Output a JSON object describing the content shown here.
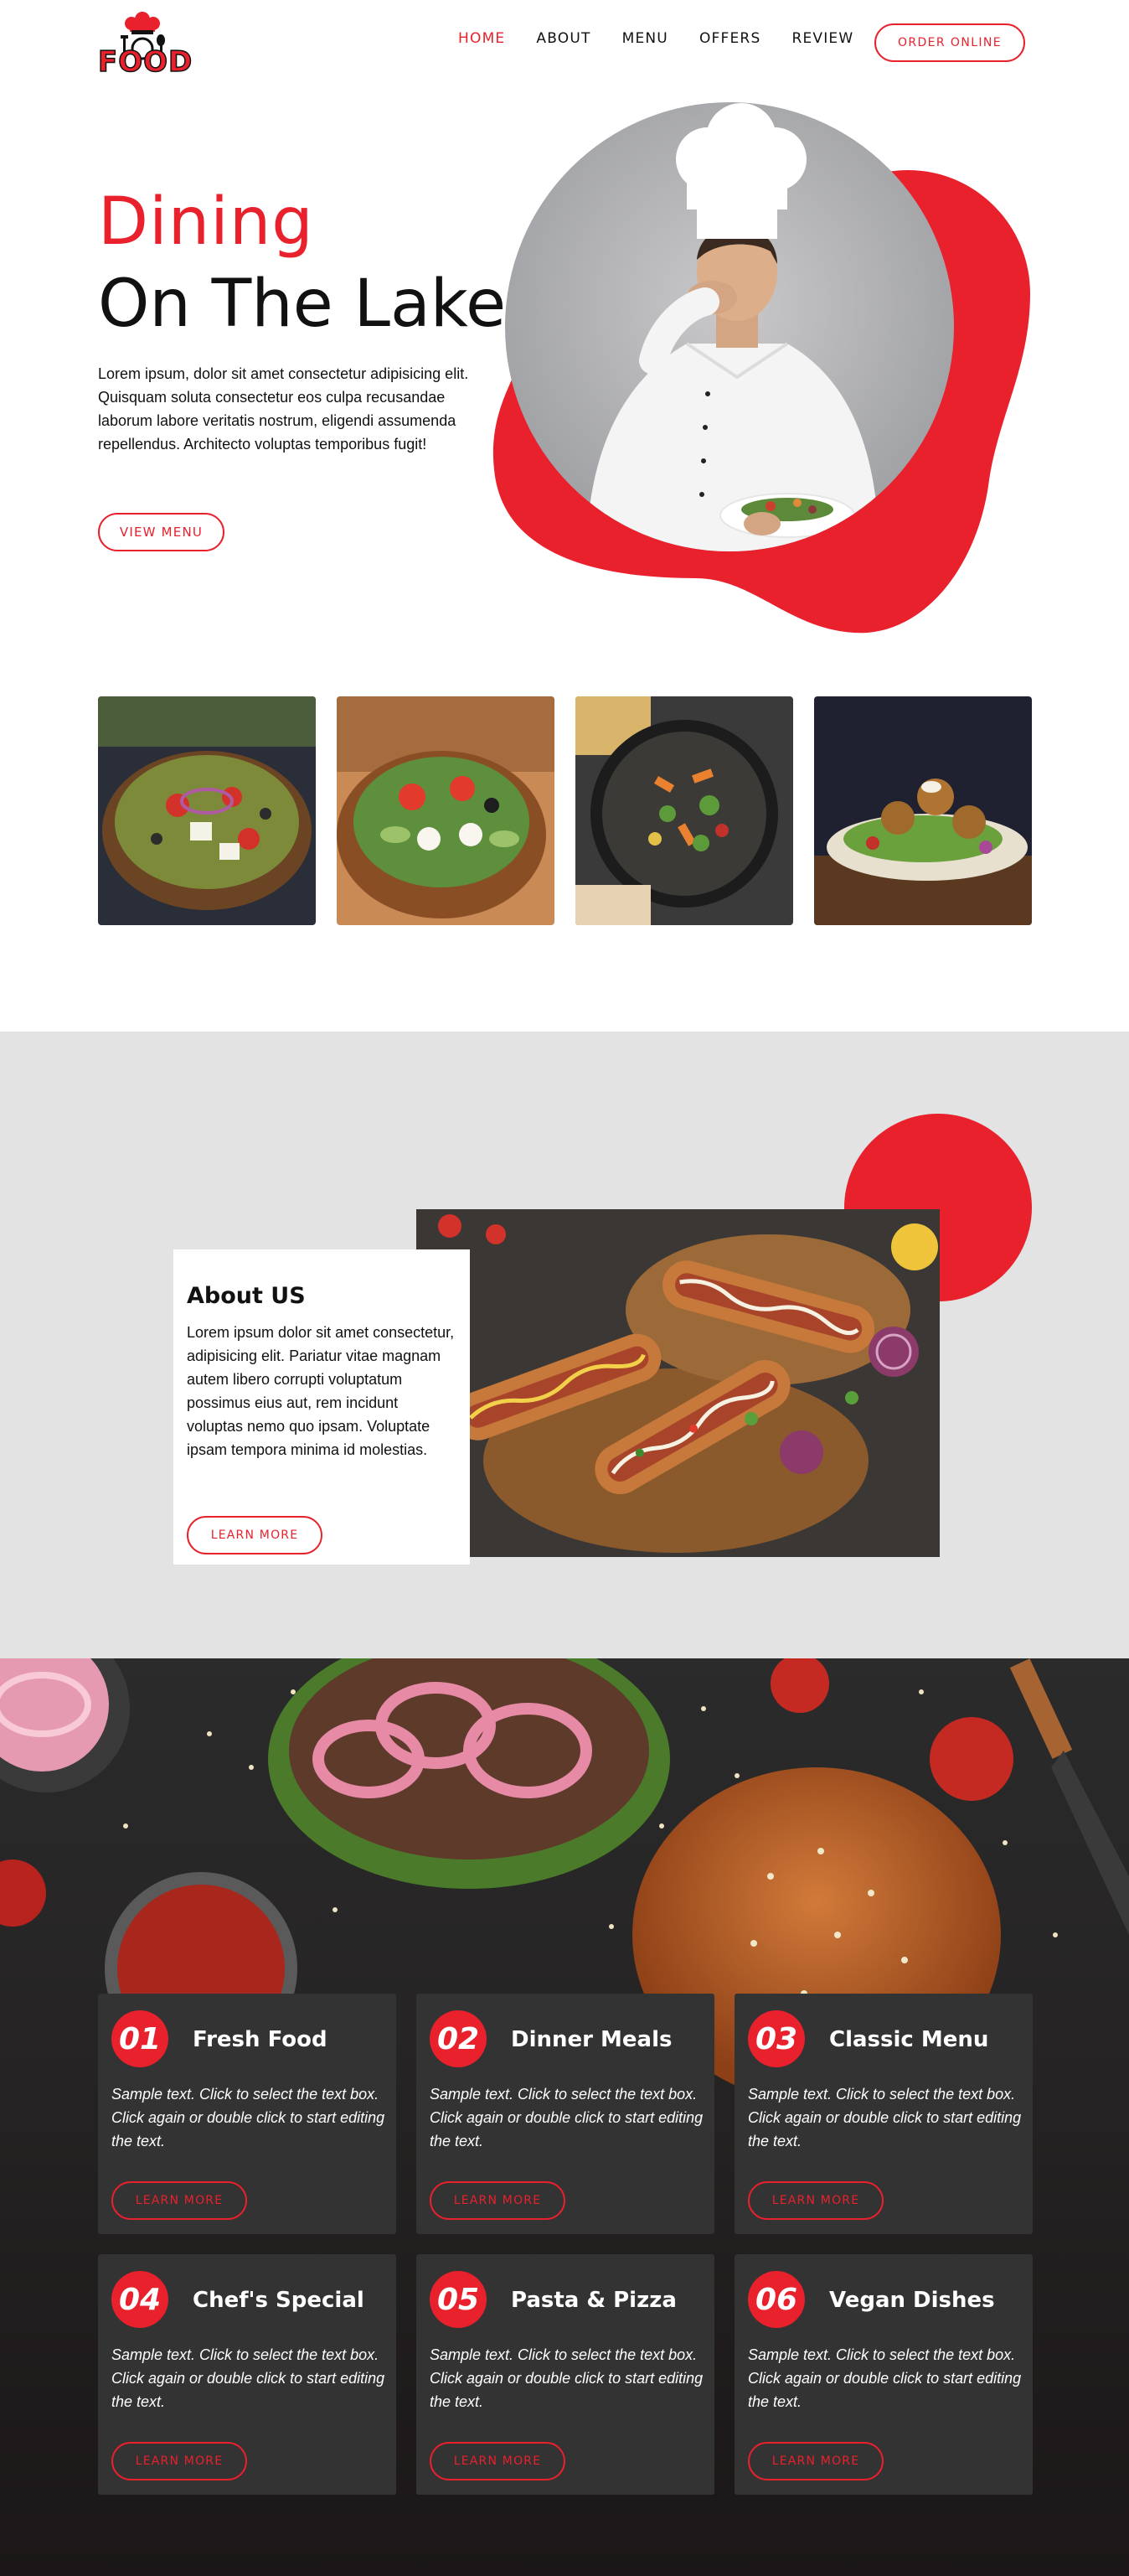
{
  "header": {
    "logo_text": "FOOD",
    "nav": [
      {
        "label": "HOME",
        "active": true
      },
      {
        "label": "ABOUT",
        "active": false
      },
      {
        "label": "MENU",
        "active": false
      },
      {
        "label": "OFFERS",
        "active": false
      },
      {
        "label": "REVIEW",
        "active": false
      }
    ],
    "order_button": "ORDER ONLINE"
  },
  "hero": {
    "title_line_1": "Dining",
    "title_line_2": "On The Lake",
    "text": "Lorem ipsum, dolor sit amet consectetur adipisicing elit. Quisquam soluta consectetur eos culpa recusandae laborum labore veritatis nostrum, eligendi assumenda repellendus. Architecto voluptas temporibus fugit!",
    "button": "VIEW MENU"
  },
  "about": {
    "heading": "About US",
    "text": "Lorem ipsum dolor sit amet consectetur, adipisicing elit. Pariatur vitae magnam autem libero corrupti voluptatum possimus eius aut, rem incidunt voluptas nemo quo ipsam. Voluptate ipsam tempora minima id molestias.",
    "button": "LEARN MORE"
  },
  "services": [
    {
      "number": "01",
      "title": "Fresh Food",
      "text": "Sample text. Click to select the text box. Click again or double click to start editing the text.",
      "button": "LEARN MORE"
    },
    {
      "number": "02",
      "title": "Dinner Meals",
      "text": "Sample text. Click to select the text box. Click again or double click to start editing the text.",
      "button": "LEARN MORE"
    },
    {
      "number": "03",
      "title": "Classic Menu",
      "text": "Sample text. Click to select the text box. Click again or double click to start editing the text.",
      "button": "LEARN MORE"
    },
    {
      "number": "04",
      "title": "Chef's Special",
      "text": "Sample text. Click to select the text box. Click again or double click to start editing the text.",
      "button": "LEARN MORE"
    },
    {
      "number": "05",
      "title": "Pasta & Pizza",
      "text": "Sample text. Click to select the text box. Click again or double click to start editing the text.",
      "button": "LEARN MORE"
    },
    {
      "number": "06",
      "title": "Vegan Dishes",
      "text": "Sample text. Click to select the text box. Click again or double click to start editing the text.",
      "button": "LEARN MORE"
    }
  ],
  "colors": {
    "accent": "#e8212d",
    "about_bg": "#e3e3e3",
    "services_bg": "#1d191a",
    "card_bg": "#333333"
  }
}
